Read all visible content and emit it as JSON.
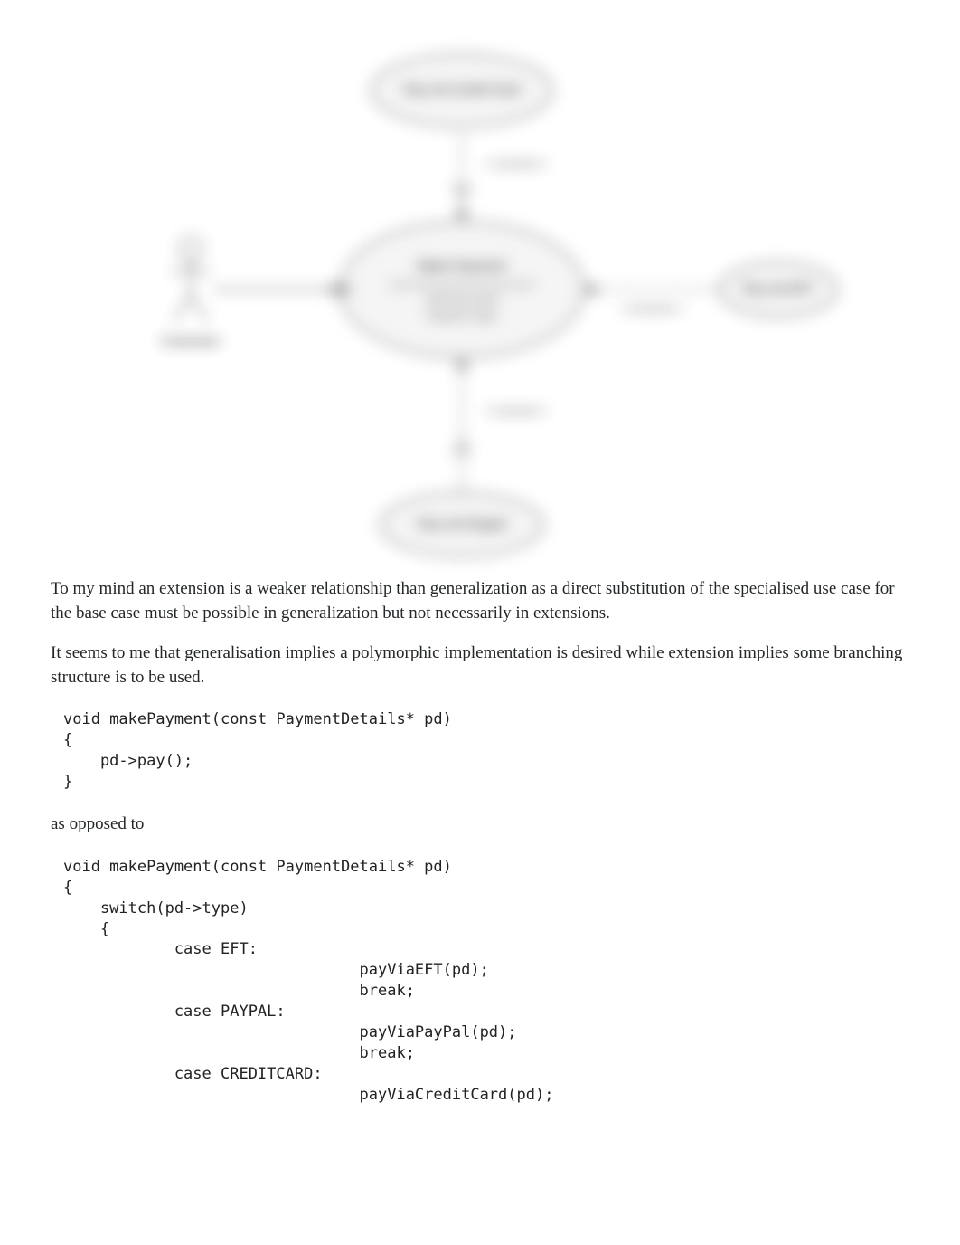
{
  "diagram": {
    "top_ellipse": "Pay via Credit Card",
    "center_title": "Make Payment",
    "center_sub1": "extension point",
    "center_sub2": "Payment Type",
    "right_ellipse": "Pay via EFT",
    "bottom_ellipse": "Pay via Paypal",
    "actor_label": "Customer",
    "extends_top": "<<extends>>",
    "extends_right": "<<extends>>",
    "extends_bottom": "<<extends>>"
  },
  "paragraph1": "To my mind an extension is a weaker relationship than generalization as a direct substitution of the specialised use case for the base case must be possible in generalization but not necessarily in extensions.",
  "paragraph2": "It seems to me that generalisation implies a polymorphic implementation is desired while extension implies some branching structure is to be used.",
  "code1": "void makePayment(const PaymentDetails* pd)\n{\n    pd->pay();\n}",
  "between": "as opposed to",
  "code2": "void makePayment(const PaymentDetails* pd)\n{\n    switch(pd->type)\n    {\n            case EFT:\n                                payViaEFT(pd);\n                                break;\n            case PAYPAL:\n                                payViaPayPal(pd);\n                                break;\n            case CREDITCARD:\n                                payViaCreditCard(pd);"
}
